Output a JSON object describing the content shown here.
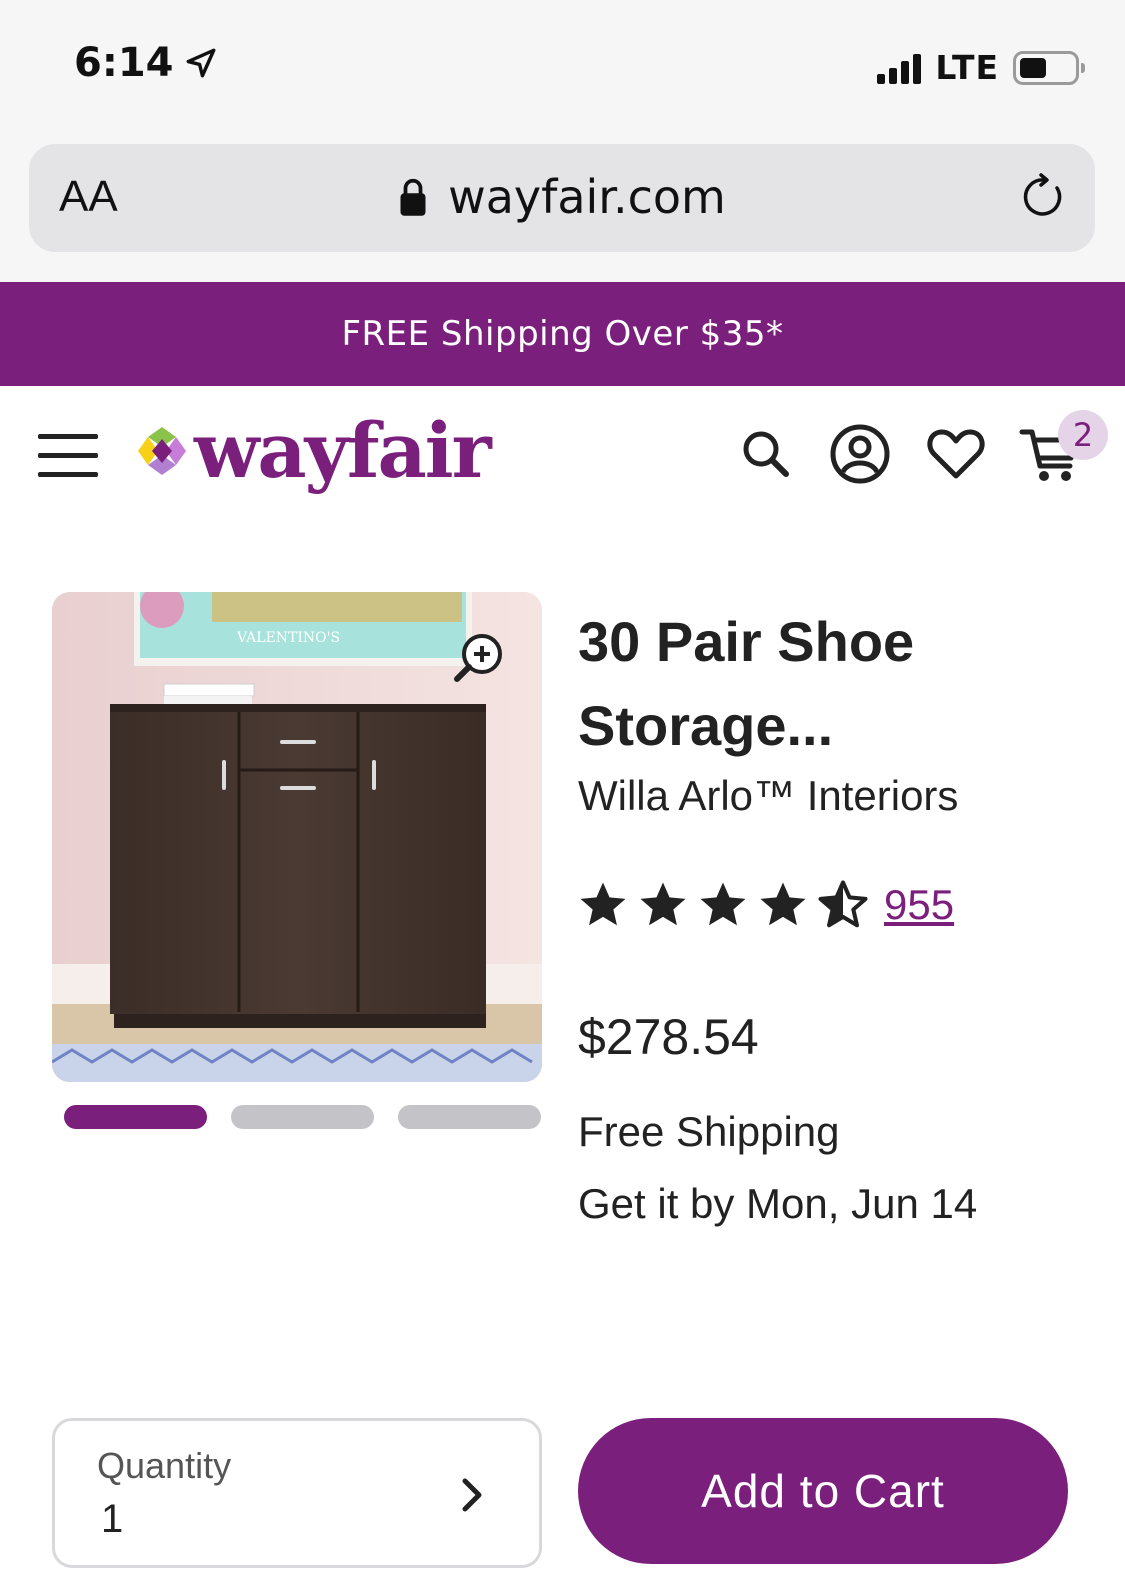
{
  "status_bar": {
    "time": "6:14",
    "network": "LTE"
  },
  "browser": {
    "text_size_label": "AA",
    "url": "wayfair.com"
  },
  "promo": {
    "text": "FREE Shipping Over $35*"
  },
  "header": {
    "logo_text": "wayfair",
    "cart_count": "2",
    "icons": [
      "menu-icon",
      "search-icon",
      "account-icon",
      "heart-icon",
      "cart-icon"
    ]
  },
  "gallery": {
    "image_count": 3,
    "active_index": 0,
    "poster_text": "VALENTINO'S"
  },
  "product": {
    "title_line1": "30 Pair Shoe",
    "title_line2": "Storage...",
    "brand": "Willa Arlo™ Interiors",
    "rating": 4.5,
    "rating_max": 5,
    "review_count": "955",
    "price": "$278.54",
    "shipping": "Free Shipping",
    "delivery": "Get it by Mon, Jun 14"
  },
  "actions": {
    "quantity_label": "Quantity",
    "quantity_value": "1",
    "add_to_cart_label": "Add to Cart"
  },
  "colors": {
    "brand_purple": "#7b1f7d",
    "badge_bg": "#e5d3e8",
    "inactive_dot": "#c4c4c8"
  }
}
